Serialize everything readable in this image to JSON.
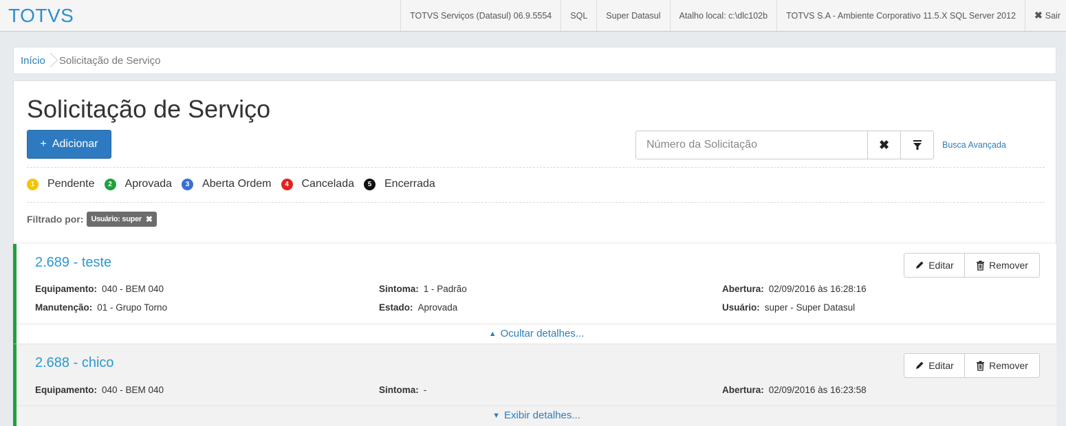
{
  "app": {
    "brand": "TOTVS"
  },
  "topnav": [
    {
      "label": "TOTVS Serviços (Datasul) 06.9.5554"
    },
    {
      "label": "SQL"
    },
    {
      "label": "Super Datasul"
    },
    {
      "label": "Atalho local: c:\\dlc102b"
    },
    {
      "label": "TOTVS S.A - Ambiente Corporativo 11.5.X SQL Server 2012"
    }
  ],
  "exit": {
    "label": "Sair"
  },
  "breadcrumb": {
    "home": "Início",
    "current": "Solicitação de Serviço"
  },
  "page": {
    "title": "Solicitação de Serviço"
  },
  "toolbar": {
    "add_label": "Adicionar",
    "search_placeholder": "Número da Solicitação",
    "advanced_search": "Busca Avançada"
  },
  "legend": [
    {
      "num": "1",
      "label": "Pendente",
      "color": "#f5c400"
    },
    {
      "num": "2",
      "label": "Aprovada",
      "color": "#1fa13c"
    },
    {
      "num": "3",
      "label": "Aberta Ordem",
      "color": "#3b6fd6"
    },
    {
      "num": "4",
      "label": "Cancelada",
      "color": "#e52020"
    },
    {
      "num": "5",
      "label": "Encerrada",
      "color": "#111111"
    }
  ],
  "filter": {
    "label": "Filtrado por:",
    "tag": "Usuário: super"
  },
  "records": [
    {
      "title": "2.689 - teste",
      "edit_label": "Editar",
      "remove_label": "Remover",
      "fields": {
        "equipamento": {
          "label": "Equipamento:",
          "value": "040 - BEM 040"
        },
        "sintoma": {
          "label": "Sintoma:",
          "value": "1 - Padrão"
        },
        "abertura": {
          "label": "Abertura:",
          "value": "02/09/2016 às 16:28:16"
        },
        "manutencao": {
          "label": "Manutenção:",
          "value": "01 - Grupo Torno"
        },
        "estado": {
          "label": "Estado:",
          "value": "Aprovada"
        },
        "usuario": {
          "label": "Usuário:",
          "value": "super - Super Datasul"
        }
      },
      "toggle_label": "Ocultar detalhes..."
    },
    {
      "title": "2.688 - chico",
      "edit_label": "Editar",
      "remove_label": "Remover",
      "fields": {
        "equipamento": {
          "label": "Equipamento:",
          "value": "040 - BEM 040"
        },
        "sintoma": {
          "label": "Sintoma:",
          "value": "-"
        },
        "abertura": {
          "label": "Abertura:",
          "value": "02/09/2016 às 16:23:58"
        }
      },
      "toggle_label": "Exibir detalhes..."
    }
  ]
}
